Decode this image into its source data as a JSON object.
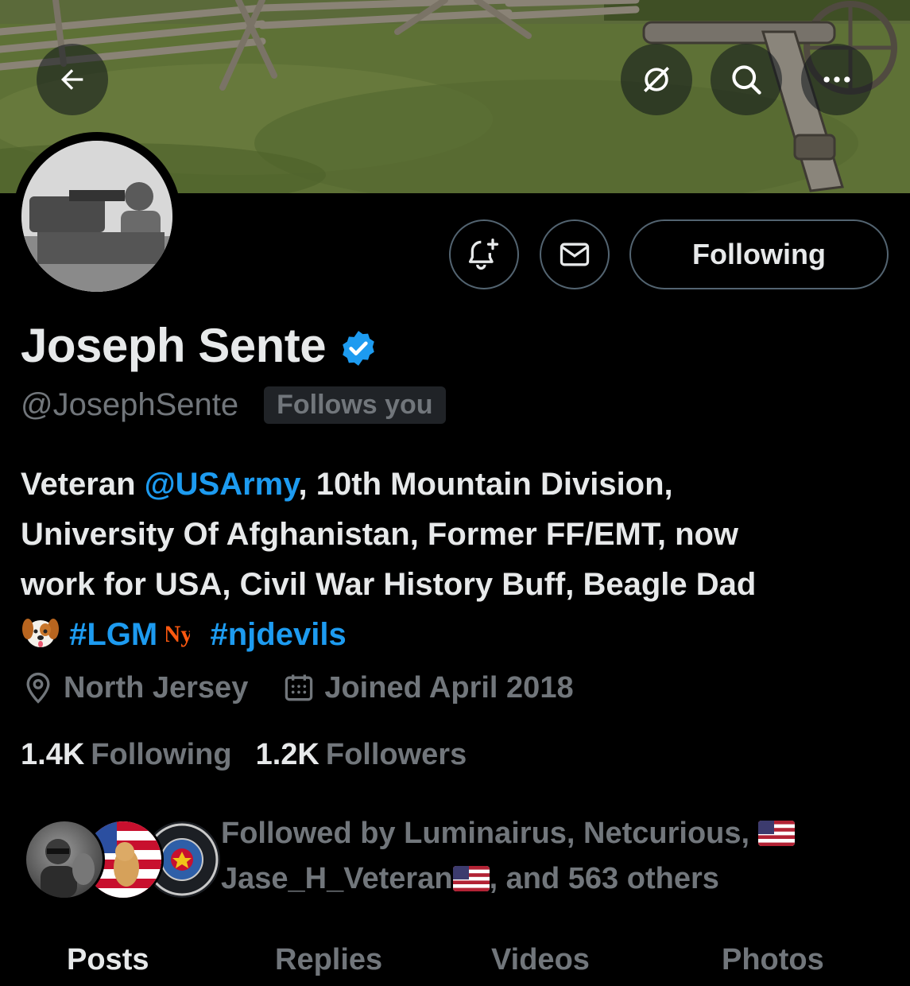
{
  "banner": {
    "back_icon": "arrow-left-icon",
    "grok_icon": "grok-icon",
    "search_icon": "search-icon",
    "more_icon": "more-horizontal-icon"
  },
  "actions": {
    "notify_icon": "bell-plus-icon",
    "message_icon": "envelope-icon",
    "following_label": "Following"
  },
  "profile": {
    "display_name": "Joseph Sente",
    "verified": true,
    "handle": "@JosephSente",
    "follows_you": "Follows you",
    "bio": {
      "line1_prefix": "Veteran ",
      "line1_mention": "@USArmy",
      "line1_suffix": ", 10th Mountain Division,",
      "line2": "University Of Afghanistan, Former FF/EMT, now",
      "line3": "work for USA, Civil War History Buff, Beagle Dad",
      "hashtag1": "#LGM",
      "hashtag2": "#njdevils"
    },
    "location": "North Jersey",
    "joined": "Joined April 2018",
    "following_count": "1.4K",
    "following_label": "Following",
    "followers_count": "1.2K",
    "followers_label": "Followers",
    "followed_by": {
      "line1": "Followed by Luminairus, Netcurious, ",
      "line2_name": "Jase_H_Veteran",
      "line2_suffix": ", and 563 others"
    }
  },
  "tabs": [
    "Posts",
    "Replies",
    "Videos",
    "Photos"
  ],
  "colors": {
    "background": "#000000",
    "text_primary": "#e7e9ea",
    "text_secondary": "#71767b",
    "accent": "#1d9bf0",
    "border": "#536471"
  }
}
